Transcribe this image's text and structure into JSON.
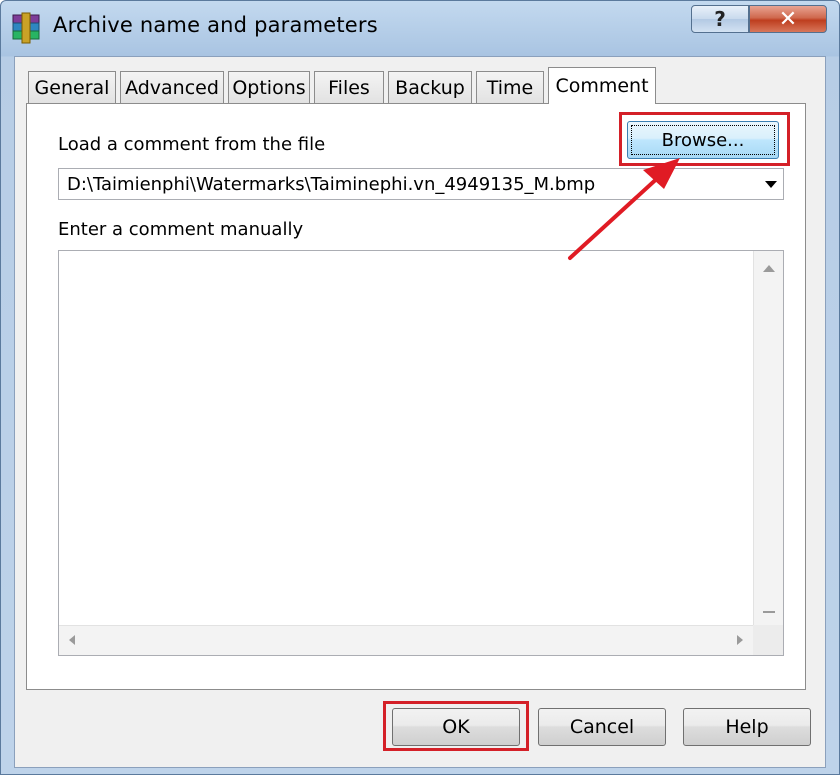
{
  "window": {
    "title": "Archive name and parameters",
    "help_glyph": "?",
    "close_glyph": "✕"
  },
  "tabs": [
    {
      "label": "General"
    },
    {
      "label": "Advanced"
    },
    {
      "label": "Options"
    },
    {
      "label": "Files"
    },
    {
      "label": "Backup"
    },
    {
      "label": "Time"
    },
    {
      "label": "Comment",
      "active": true
    }
  ],
  "comment_tab": {
    "load_label": "Load a comment from the file",
    "browse_label": "Browse...",
    "file_path": "D:\\Taimienphi\\Watermarks\\Taiminephi.vn_4949135_M.bmp",
    "manual_label": "Enter a comment manually",
    "manual_text": ""
  },
  "footer": {
    "ok_label": "OK",
    "cancel_label": "Cancel",
    "help_label": "Help"
  },
  "colors": {
    "highlight": "#d42028",
    "selection_focus": "#3c7fb1"
  },
  "icons": [
    "winrar-archive-icon",
    "help-icon",
    "close-icon",
    "chevron-down-icon",
    "scroll-up-icon",
    "scroll-left-icon",
    "scroll-right-icon",
    "annotation-arrow"
  ]
}
